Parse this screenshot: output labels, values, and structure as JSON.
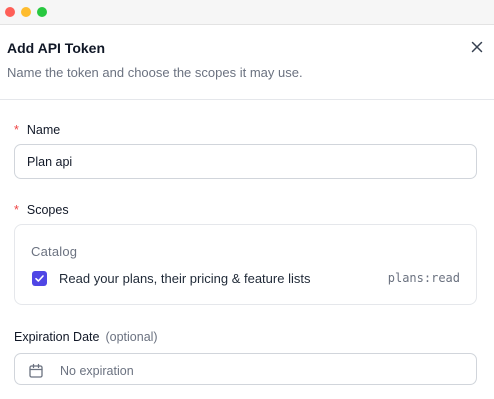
{
  "window": {
    "controls": [
      "close",
      "minimize",
      "maximize"
    ],
    "colors": {
      "close": "#fe5f57",
      "minimize": "#febc2e",
      "maximize": "#28c840"
    }
  },
  "modal": {
    "title": "Add API Token",
    "description": "Name the token and choose the scopes it may use.",
    "close_icon": "close-icon"
  },
  "form": {
    "required_marker": "*",
    "name": {
      "label": "Name",
      "value": "Plan api"
    },
    "scopes": {
      "label": "Scopes",
      "group_title": "Catalog",
      "items": [
        {
          "label": "Read your plans, their pricing & feature lists",
          "code": "plans:read",
          "checked": true
        }
      ]
    },
    "expiration": {
      "label": "Expiration Date",
      "optional_label": "(optional)",
      "value": "No expiration",
      "icon": "calendar-icon"
    }
  },
  "colors": {
    "accent": "#4f46e5",
    "required": "#ef4444"
  }
}
